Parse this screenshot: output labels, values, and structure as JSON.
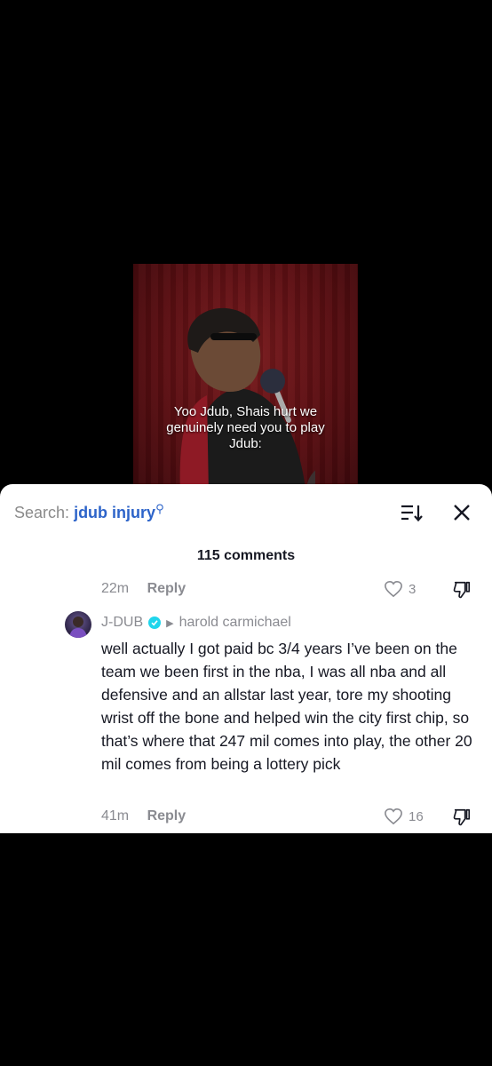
{
  "video": {
    "caption": "Yoo Jdub, Shais hurt we genuinely need you to play Jdub:"
  },
  "sheet": {
    "search_prefix": "Search:",
    "search_query": "jdub injury",
    "comment_count": "115 comments"
  },
  "comments": [
    {
      "time": "22m",
      "reply_label": "Reply",
      "likes": "3"
    },
    {
      "author": "J-DUB",
      "verified": true,
      "reply_to": "harold carmichael",
      "text": "well actually I got paid bc 3/4 years I’ve been on the team we been first in the nba, I was all nba and all defensive and an allstar last year, tore my shooting wrist off the bone and helped win the city first chip, so that’s where that 247 mil comes into play, the other 20 mil comes from being a lottery pick",
      "time": "41m",
      "reply_label": "Reply",
      "likes": "16"
    }
  ],
  "colors": {
    "query": "#2c63c9",
    "verified_badge": "#20d5ec",
    "muted": "#8a8b91"
  }
}
